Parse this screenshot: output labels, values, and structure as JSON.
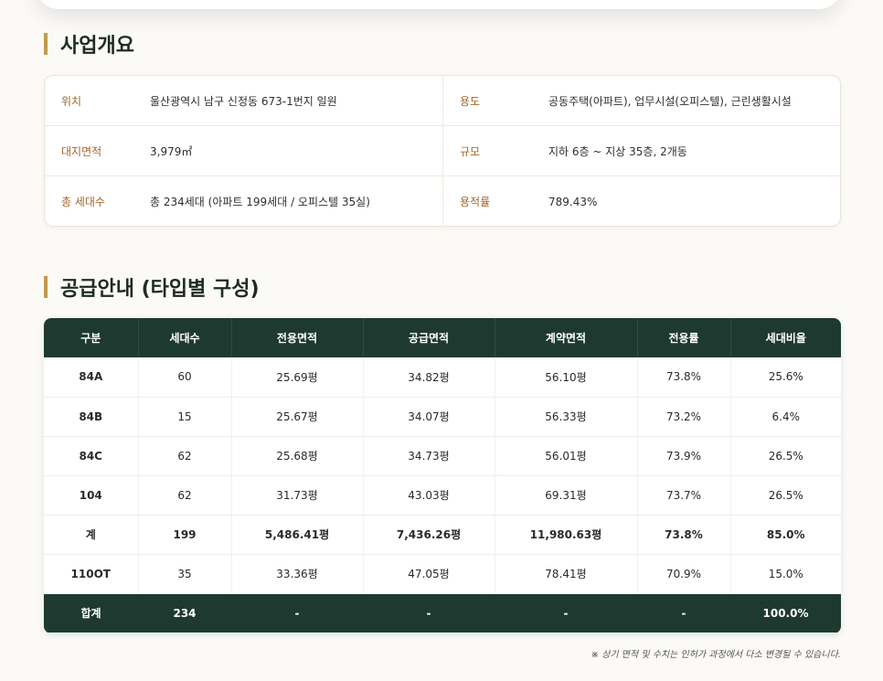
{
  "overview": {
    "title": "사업개요",
    "rows": [
      {
        "label_left": "위치",
        "value_left": "울산광역시 남구 신정동 673-1번지 일원",
        "label_right": "용도",
        "value_right": "공동주택(아파트), 업무시설(오피스텔), 근린생활시설"
      },
      {
        "label_left": "대지면적",
        "value_left": "3,979㎡",
        "label_right": "규모",
        "value_right": "지하 6층 ~ 지상 35층, 2개동"
      },
      {
        "label_left": "총 세대수",
        "value_left": "총 234세대 (아파트 199세대 / 오피스텔 35실)",
        "label_right": "용적률",
        "value_right": "789.43%"
      }
    ]
  },
  "supply": {
    "title": "공급안내 (타입별 구성)",
    "headers": [
      "구분",
      "세대수",
      "전용면적",
      "공급면적",
      "계약면적",
      "전용률",
      "세대비율"
    ],
    "rows": [
      [
        "84A",
        "60",
        "25.69평",
        "34.82평",
        "56.10평",
        "73.8%",
        "25.6%"
      ],
      [
        "84B",
        "15",
        "25.67평",
        "34.07평",
        "56.33평",
        "73.2%",
        "6.4%"
      ],
      [
        "84C",
        "62",
        "25.68평",
        "34.73평",
        "56.01평",
        "73.9%",
        "26.5%"
      ],
      [
        "104",
        "62",
        "31.73평",
        "43.03평",
        "69.31평",
        "73.7%",
        "26.5%"
      ]
    ],
    "subtotal": [
      "계",
      "199",
      "5,486.41평",
      "7,436.26평",
      "11,980.63평",
      "73.8%",
      "85.0%"
    ],
    "officetel": [
      "110OT",
      "35",
      "33.36평",
      "47.05평",
      "78.41평",
      "70.9%",
      "15.0%"
    ],
    "total": [
      "합계",
      "234",
      "-",
      "-",
      "-",
      "-",
      "100.0%"
    ],
    "note": "※ 상기 면적 및 수치는 인허가 과정에서 다소 변경될 수 있습니다."
  },
  "colors": {
    "accent_gold": "#c39a4a",
    "header_green": "#1e3a30",
    "label_brown": "#a1672b"
  }
}
